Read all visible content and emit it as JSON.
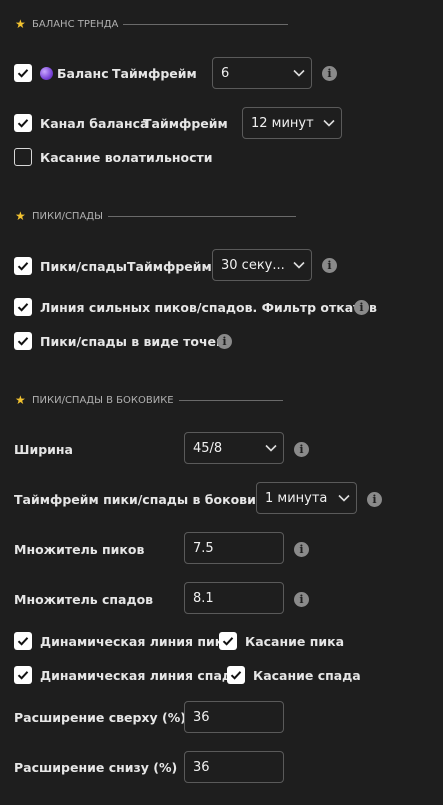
{
  "sections": {
    "trend": "БАЛАНС ТРЕНДА",
    "peaks": "ПИКИ/СПАДЫ",
    "sideways": "ПИКИ/СПАДЫ В БОКОВИКЕ"
  },
  "trend": {
    "balance_label": "Баланс",
    "balance_checked": true,
    "balance_tf_label": "Таймфрейм",
    "balance_tf_value": "6",
    "channel_label": "Канал баланса",
    "channel_checked": true,
    "channel_tf_label": "Таймфрейм",
    "channel_tf_value": "12 минут",
    "volatility_label": "Касание волатильности",
    "volatility_checked": false
  },
  "peaks": {
    "pv_label": "Пики/спады",
    "pv_checked": true,
    "pv_tf_label": "Таймфрейм",
    "pv_tf_value": "30 секу...",
    "strong_label": "Линия сильных пиков/спадов. Фильтр откатов",
    "strong_checked": true,
    "dots_label": "Пики/спады в виде точек",
    "dots_checked": true
  },
  "sideways": {
    "width_label": "Ширина",
    "width_value": "45/8",
    "tf_label": "Таймфрейм пики/спады в боковике",
    "tf_value": "1 минута",
    "peak_mult_label": "Множитель пиков",
    "peak_mult_value": "7.5",
    "trough_mult_label": "Множитель спадов",
    "trough_mult_value": "8.1",
    "dyn_peak_label": "Динамическая линия пика",
    "dyn_peak_checked": true,
    "touch_peak_label": "Касание пика",
    "touch_peak_checked": true,
    "dyn_trough_label": "Динамическая линия спада",
    "dyn_trough_checked": true,
    "touch_trough_label": "Касание спада",
    "touch_trough_checked": true,
    "ext_top_label": "Расширение сверху (%)",
    "ext_top_value": "36",
    "ext_bottom_label": "Расширение снизу (%)",
    "ext_bottom_value": "36"
  },
  "icons": {
    "star": "star-icon",
    "check": "check-icon",
    "info": "info-icon",
    "chevron": "chevron-down-icon",
    "orb": "purple-orb-icon"
  },
  "colors": {
    "background": "#1e1e1e",
    "star": "#f2c230",
    "checkbox": "#ffffff",
    "border": "#5a5a5a"
  }
}
